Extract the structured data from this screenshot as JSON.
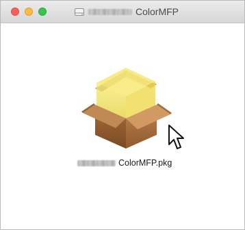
{
  "window": {
    "title": "ColorMFP",
    "title_icon": "disk-icon",
    "title_prefix_redacted": true
  },
  "traffic_lights": [
    {
      "name": "close",
      "color": "#fc605c"
    },
    {
      "name": "minimize",
      "color": "#fdbc40"
    },
    {
      "name": "zoom",
      "color": "#34c749"
    }
  ],
  "content": {
    "package_icon": "package-icon",
    "file_name": "ColorMFP.pkg",
    "file_prefix_redacted": true,
    "cursor_icon": "arrow-cursor-icon"
  }
}
